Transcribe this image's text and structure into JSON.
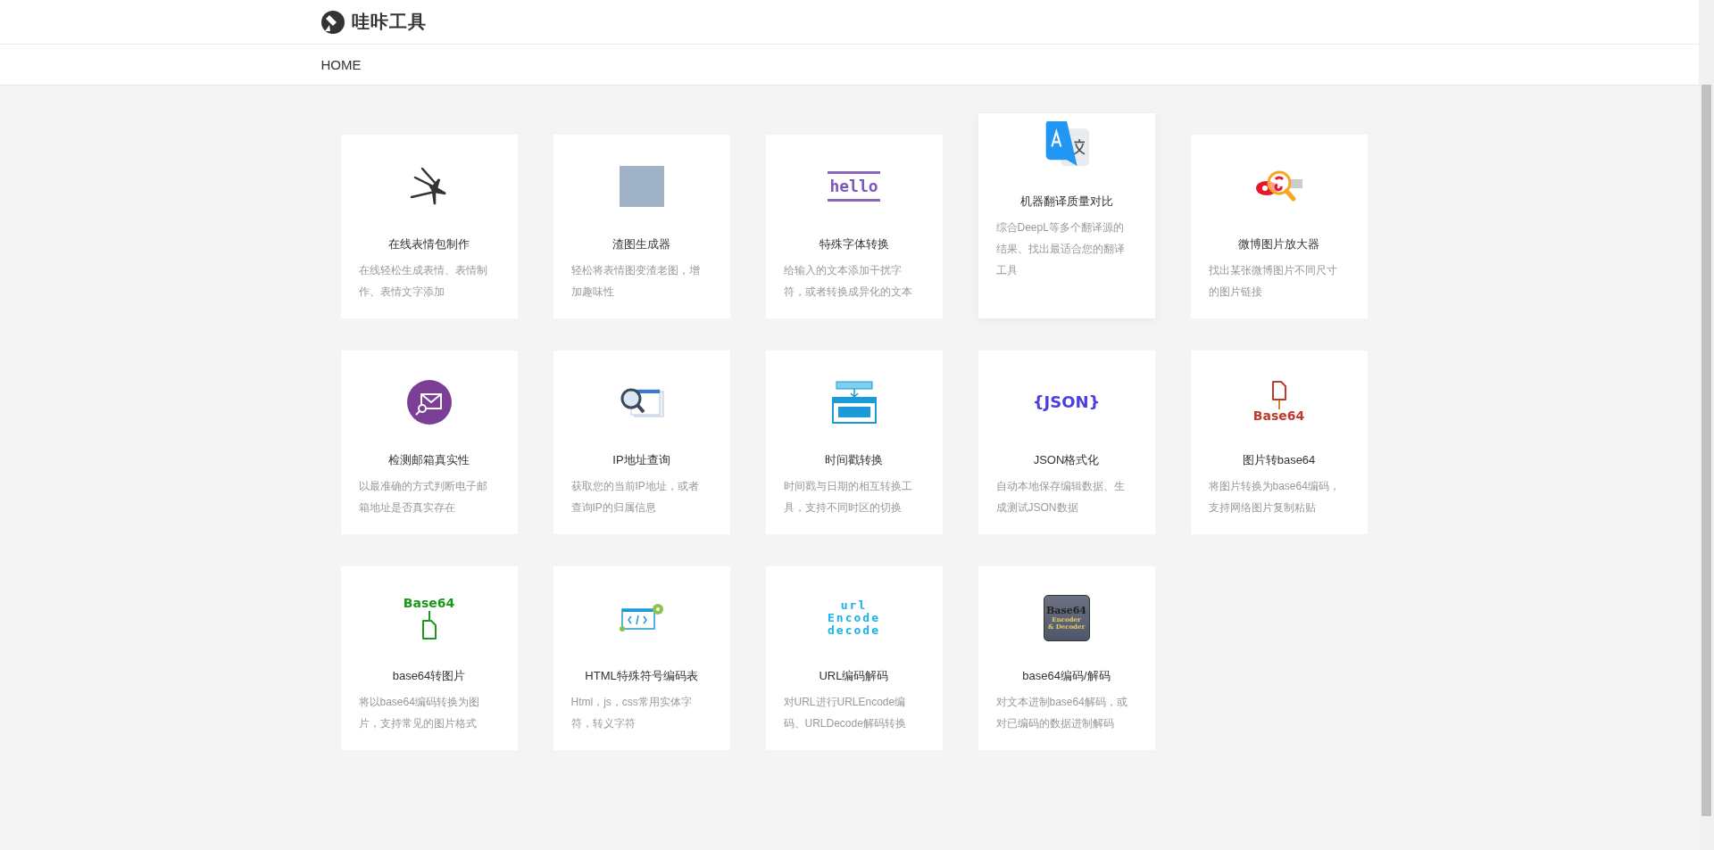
{
  "header": {
    "logo_text": "哇咔工具"
  },
  "nav": {
    "items": [
      {
        "label": "HOME",
        "selected": false
      }
    ]
  },
  "cards": [
    {
      "kind": "meme",
      "title": "在线表情包制作",
      "description": "在线轻松生成表情、表情制作、表情文字添加",
      "raised": false
    },
    {
      "kind": "photo",
      "title": "渣图生成器",
      "description": "轻松将表情图变渣老图，增加趣味性",
      "raised": false
    },
    {
      "kind": "hello",
      "icon_text": [
        "hello"
      ],
      "title": "特殊字体转换",
      "description": "给输入的文本添加干扰字符，或者转换成异化的文本",
      "raised": false
    },
    {
      "kind": "translate",
      "title": "机器翻译质量对比",
      "description": "综合DeepL等多个翻译源的结果、找出最适合您的翻译工具",
      "raised": true
    },
    {
      "kind": "weibo",
      "title": "微博图片放大器",
      "description": "找出某张微博图片不同尺寸的图片链接",
      "raised": false
    },
    {
      "kind": "mail",
      "title": "检测邮箱真实性",
      "description": "以最准确的方式判断电子邮箱地址是否真实存在",
      "raised": false
    },
    {
      "kind": "ip",
      "title": "IP地址查询",
      "description": "获取您的当前IP地址，或者查询IP的归属信息",
      "raised": false
    },
    {
      "kind": "time",
      "title": "时间戳转换",
      "description": "时间戳与日期的相互转换工具，支持不同时区的切换",
      "raised": false
    },
    {
      "kind": "json",
      "icon_text": [
        "{JSON}"
      ],
      "title": "JSON格式化",
      "description": "自动本地保存编辑数据、生成测试JSON数据",
      "raised": false
    },
    {
      "kind": "img2b64",
      "icon_text": [
        "Base64"
      ],
      "title": "图片转base64",
      "description": "将图片转换为base64编码，支持网络图片复制粘贴",
      "raised": false
    },
    {
      "kind": "b642img",
      "icon_text": [
        "Base64"
      ],
      "title": "base64转图片",
      "description": "将以base64编码转换为图片，支持常见的图片格式",
      "raised": false
    },
    {
      "kind": "html",
      "title": "HTML特殊符号编码表",
      "description": "Html，js，css常用实体字符，转义字符",
      "raised": false
    },
    {
      "kind": "url",
      "icon_text": [
        "url",
        "Encode",
        "decode"
      ],
      "title": "URL编码解码",
      "description": "对URL进行URLEncode编码、URLDecode解码转换",
      "raised": false
    },
    {
      "kind": "b64coder",
      "icon_text": [
        "Base64",
        "Encoder",
        "& Decoder"
      ],
      "title": "base64编码/解码",
      "description": "对文本进制base64解码，或对已编码的数据进制解码",
      "raised": false
    }
  ]
}
